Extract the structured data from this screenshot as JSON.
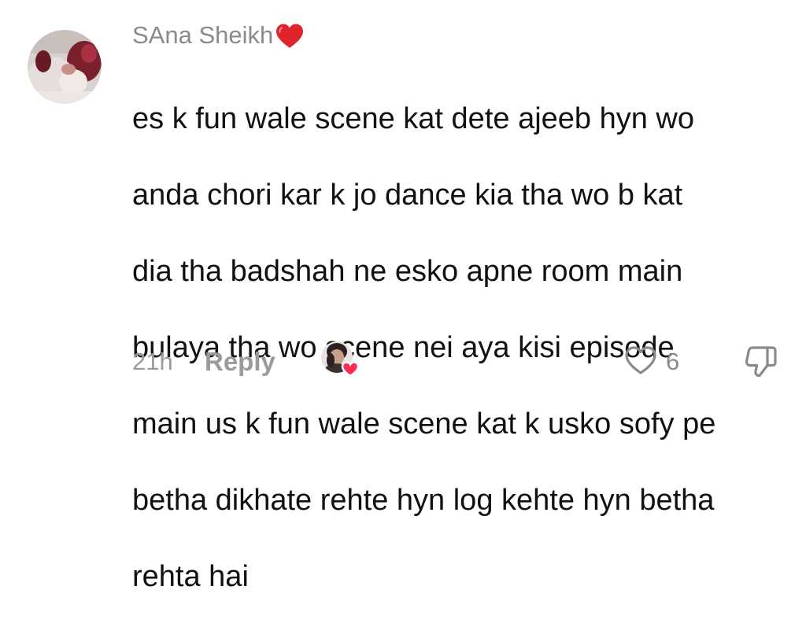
{
  "comment": {
    "username": "SAna Sheikh",
    "username_emoji": "heart-emoji",
    "text_lines": [
      "es k fun wale scene kat dete ajeeb hyn wo",
      "anda chori kar k jo dance kia tha wo b kat",
      "dia tha badshah ne esko apne room main",
      "bulaya tha wo scene nei aya kisi episode",
      "main us k fun wale scene kat k usko sofy pe",
      "betha dikhate rehte hyn log kehte hyn betha",
      "rehta hai"
    ],
    "timestamp": "21h",
    "reply_label": "Reply",
    "like_count": "6",
    "creator_liked": true,
    "icons": {
      "avatar": "user-avatar",
      "creator": "creator-liked-avatar-icon",
      "like": "heart-outline-icon",
      "dislike": "thumbs-down-outline-icon"
    },
    "colors": {
      "heart_emoji": "#e0242b",
      "creator_heart": "#fe2c55",
      "muted_text": "#8a8a8a",
      "body_text": "#111111"
    }
  }
}
